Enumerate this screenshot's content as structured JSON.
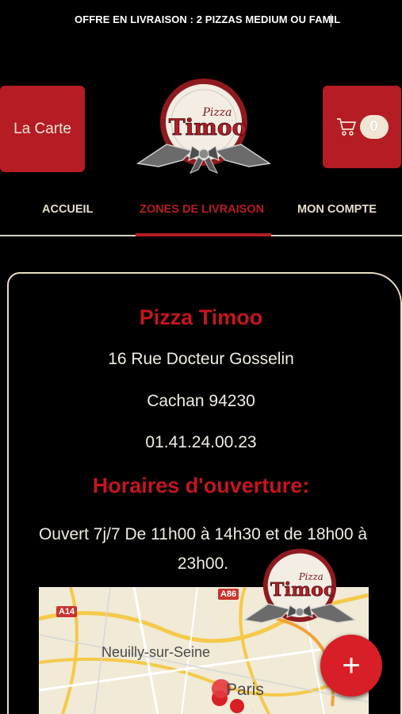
{
  "promo": {
    "text": "OFFRE EN LIVRAISON : 2 PIZZAS MEDIUM OU FAMIL"
  },
  "header": {
    "menu_label": "La Carte",
    "cart_count": "0",
    "logo_top": "Pizza",
    "logo_main": "Timoo"
  },
  "nav": {
    "items": [
      {
        "label": "ACCUEIL"
      },
      {
        "label": "ZONES DE LIVRAISON"
      },
      {
        "label": "MON COMPTE"
      }
    ]
  },
  "info": {
    "name": "Pizza Timoo",
    "address": "16 Rue Docteur Gosselin",
    "city": "Cachan 94230",
    "phone": "01.41.24.00.23",
    "hours_title": "Horaires d'ouverture:",
    "hours_text": "Ouvert 7j/7 De 11h00 à 14h30 et de 18h00 à 23h00."
  },
  "map": {
    "labels": {
      "neuilly": "Neuilly-sur-Seine",
      "paris": "Paris",
      "a14": "A14",
      "a86": "A86"
    }
  },
  "fab": {
    "symbol": "+"
  },
  "colors": {
    "brand_red": "#b51c24",
    "accent_red": "#c4161e",
    "cream": "#f1e6d4",
    "background": "#000000"
  },
  "icons": {
    "cart": "cart-icon",
    "plus": "plus-icon",
    "map_marker": "map-marker-icon"
  }
}
